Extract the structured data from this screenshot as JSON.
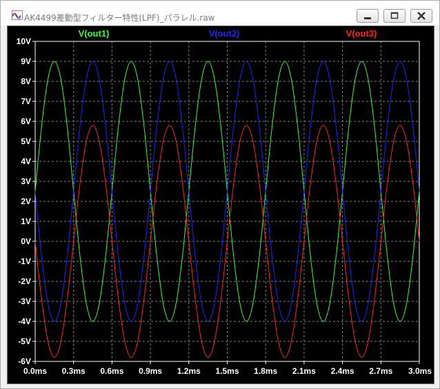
{
  "window": {
    "title": "AK4499差動型フィルター特性(LPF)_パラレル.raw",
    "icon": "waveform-icon",
    "controls": {
      "minimize": "minimize-icon",
      "maximize": "maximize-icon",
      "close": "close-icon"
    }
  },
  "chart_data": {
    "type": "line",
    "title": "",
    "xlabel": "",
    "ylabel": "",
    "xlim": [
      0.0,
      3.0
    ],
    "ylim": [
      -6,
      10
    ],
    "grid": true,
    "legend": "top",
    "x_ticks": [
      "0.0ms",
      "0.3ms",
      "0.6ms",
      "0.9ms",
      "1.2ms",
      "1.5ms",
      "1.8ms",
      "2.1ms",
      "2.4ms",
      "2.7ms",
      "3.0ms"
    ],
    "y_ticks": [
      "10V",
      "9V",
      "8V",
      "7V",
      "6V",
      "5V",
      "4V",
      "3V",
      "2V",
      "1V",
      "0V",
      "-1V",
      "-2V",
      "-3V",
      "-4V",
      "-5V",
      "-6V"
    ],
    "background": "#000000",
    "grid_color": "#808080",
    "axis_text_color": "#ffffff",
    "series": [
      {
        "name": "V(out1)",
        "color": "#33ff33",
        "x": [
          0.0,
          0.05,
          0.1,
          0.15,
          0.2,
          0.25,
          0.3,
          0.35,
          0.4,
          0.45,
          0.5,
          0.55,
          0.6,
          0.65,
          0.7,
          0.75,
          0.8,
          0.85,
          0.9,
          0.95,
          1.0,
          1.05,
          1.1,
          1.15,
          1.2,
          1.25,
          1.3,
          1.35,
          1.4,
          1.45,
          1.5,
          1.55,
          1.6,
          1.65,
          1.7,
          1.75,
          1.8,
          1.85,
          1.9,
          1.95,
          2.0,
          2.05,
          2.1,
          2.15,
          2.2,
          2.25,
          2.3,
          2.35,
          2.4,
          2.45,
          2.5,
          2.55,
          2.6,
          2.65,
          2.7,
          2.75,
          2.8,
          2.85,
          2.9,
          2.95,
          3.0
        ],
        "values": [
          2.5,
          5.75,
          8.13,
          9.0,
          8.13,
          5.75,
          2.5,
          -0.75,
          -3.13,
          -4.0,
          -3.13,
          -0.75,
          2.5,
          5.75,
          8.13,
          9.0,
          8.13,
          5.75,
          2.5,
          -0.75,
          -3.13,
          -4.0,
          -3.13,
          -0.75,
          2.5,
          5.75,
          8.13,
          9.0,
          8.13,
          5.75,
          2.5,
          -0.75,
          -3.13,
          -4.0,
          -3.13,
          -0.75,
          2.5,
          5.75,
          8.13,
          9.0,
          8.13,
          5.75,
          2.5,
          -0.75,
          -3.13,
          -4.0,
          -3.13,
          -0.75,
          2.5,
          5.75,
          8.13,
          9.0,
          8.13,
          5.75,
          2.5,
          -0.75,
          -3.13,
          -4.0,
          -3.13,
          -0.75,
          2.5
        ]
      },
      {
        "name": "V(out2)",
        "color": "#2222ff",
        "x": [
          0.0,
          0.05,
          0.1,
          0.15,
          0.2,
          0.25,
          0.3,
          0.35,
          0.4,
          0.45,
          0.5,
          0.55,
          0.6,
          0.65,
          0.7,
          0.75,
          0.8,
          0.85,
          0.9,
          0.95,
          1.0,
          1.05,
          1.1,
          1.15,
          1.2,
          1.25,
          1.3,
          1.35,
          1.4,
          1.45,
          1.5,
          1.55,
          1.6,
          1.65,
          1.7,
          1.75,
          1.8,
          1.85,
          1.9,
          1.95,
          2.0,
          2.05,
          2.1,
          2.15,
          2.2,
          2.25,
          2.3,
          2.35,
          2.4,
          2.45,
          2.5,
          2.55,
          2.6,
          2.65,
          2.7,
          2.75,
          2.8,
          2.85,
          2.9,
          2.95,
          3.0
        ],
        "values": [
          2.5,
          -0.75,
          -3.13,
          -4.0,
          -3.13,
          -0.75,
          2.5,
          5.75,
          8.13,
          9.0,
          8.13,
          5.75,
          2.5,
          -0.75,
          -3.13,
          -4.0,
          -3.13,
          -0.75,
          2.5,
          5.75,
          8.13,
          9.0,
          8.13,
          5.75,
          2.5,
          -0.75,
          -3.13,
          -4.0,
          -3.13,
          -0.75,
          2.5,
          5.75,
          8.13,
          9.0,
          8.13,
          5.75,
          2.5,
          -0.75,
          -3.13,
          -4.0,
          -3.13,
          -0.75,
          2.5,
          5.75,
          8.13,
          9.0,
          8.13,
          5.75,
          2.5,
          -0.75,
          -3.13,
          -4.0,
          -3.13,
          -0.75,
          2.5,
          5.75,
          8.13,
          9.0,
          8.13,
          5.75,
          2.5
        ]
      },
      {
        "name": "V(out3)",
        "color": "#ff2222",
        "x": [
          0.0,
          0.05,
          0.1,
          0.15,
          0.2,
          0.25,
          0.3,
          0.35,
          0.4,
          0.45,
          0.5,
          0.55,
          0.6,
          0.65,
          0.7,
          0.75,
          0.8,
          0.85,
          0.9,
          0.95,
          1.0,
          1.05,
          1.1,
          1.15,
          1.2,
          1.25,
          1.3,
          1.35,
          1.4,
          1.45,
          1.5,
          1.55,
          1.6,
          1.65,
          1.7,
          1.75,
          1.8,
          1.85,
          1.9,
          1.95,
          2.0,
          2.05,
          2.1,
          2.15,
          2.2,
          2.25,
          2.3,
          2.35,
          2.4,
          2.45,
          2.5,
          2.55,
          2.6,
          2.65,
          2.7,
          2.75,
          2.8,
          2.85,
          2.9,
          2.95,
          3.0
        ],
        "values": [
          0.0,
          -2.9,
          -5.02,
          -5.8,
          -5.02,
          -2.9,
          0.0,
          2.9,
          5.02,
          5.8,
          5.02,
          2.9,
          0.0,
          -2.9,
          -5.02,
          -5.8,
          -5.02,
          -2.9,
          0.0,
          2.9,
          5.02,
          5.8,
          5.02,
          2.9,
          0.0,
          -2.9,
          -5.02,
          -5.8,
          -5.02,
          -2.9,
          0.0,
          2.9,
          5.02,
          5.8,
          5.02,
          2.9,
          0.0,
          -2.9,
          -5.02,
          -5.8,
          -5.02,
          -2.9,
          0.0,
          2.9,
          5.02,
          5.8,
          5.02,
          2.9,
          0.0,
          -2.9,
          -5.02,
          -5.8,
          -5.02,
          -2.9,
          0.0,
          2.9,
          5.02,
          5.8,
          5.02,
          2.9,
          0.0
        ]
      }
    ]
  }
}
